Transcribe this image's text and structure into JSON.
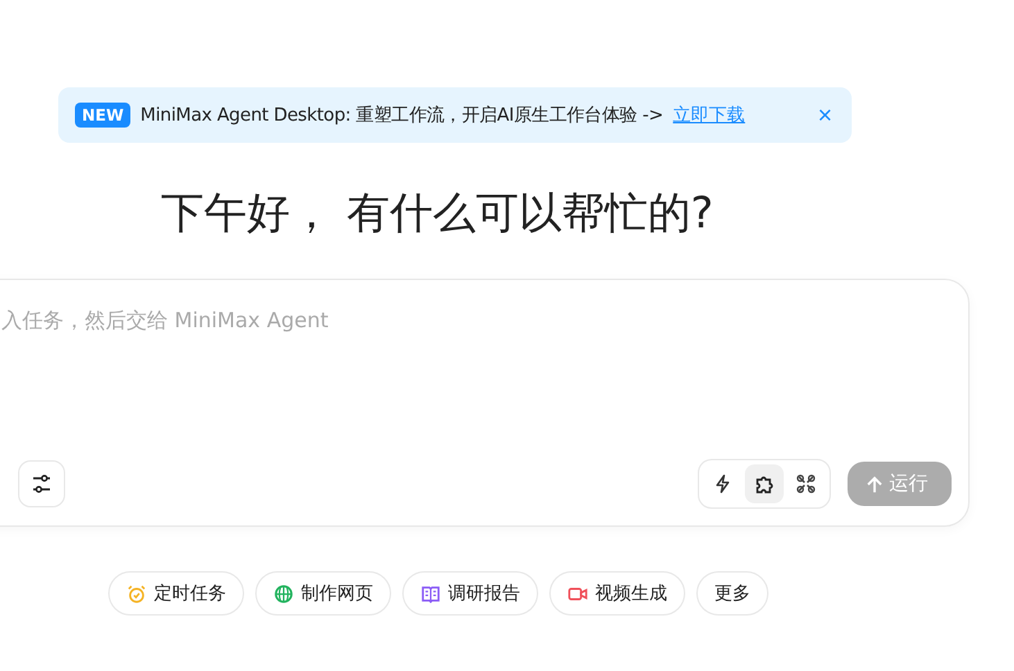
{
  "banner": {
    "badge": "NEW",
    "message": "MiniMax Agent Desktop: 重塑工作流，开启AI原生工作台体验 ->",
    "link": "立即下载",
    "close": "×"
  },
  "greeting": "下午好， 有什么可以帮忙的?",
  "composer": {
    "placeholder": "入任务，然后交给 MiniMax Agent",
    "modes": [
      {
        "kind": "bolt",
        "selected": false
      },
      {
        "kind": "puzzle",
        "selected": true
      },
      {
        "kind": "tools",
        "selected": false
      }
    ],
    "run_button": {
      "label": "运行",
      "disabled": true
    }
  },
  "shortcuts": [
    {
      "kind": "alarm",
      "label": "定时任务",
      "color": "#f5b324"
    },
    {
      "kind": "globe",
      "label": "制作网页",
      "color": "#22b35e"
    },
    {
      "kind": "book",
      "label": "调研报告",
      "color": "#8b5cf6"
    },
    {
      "kind": "video",
      "label": "视频生成",
      "color": "#f0505a"
    },
    {
      "kind": "none",
      "label": "更多"
    }
  ]
}
